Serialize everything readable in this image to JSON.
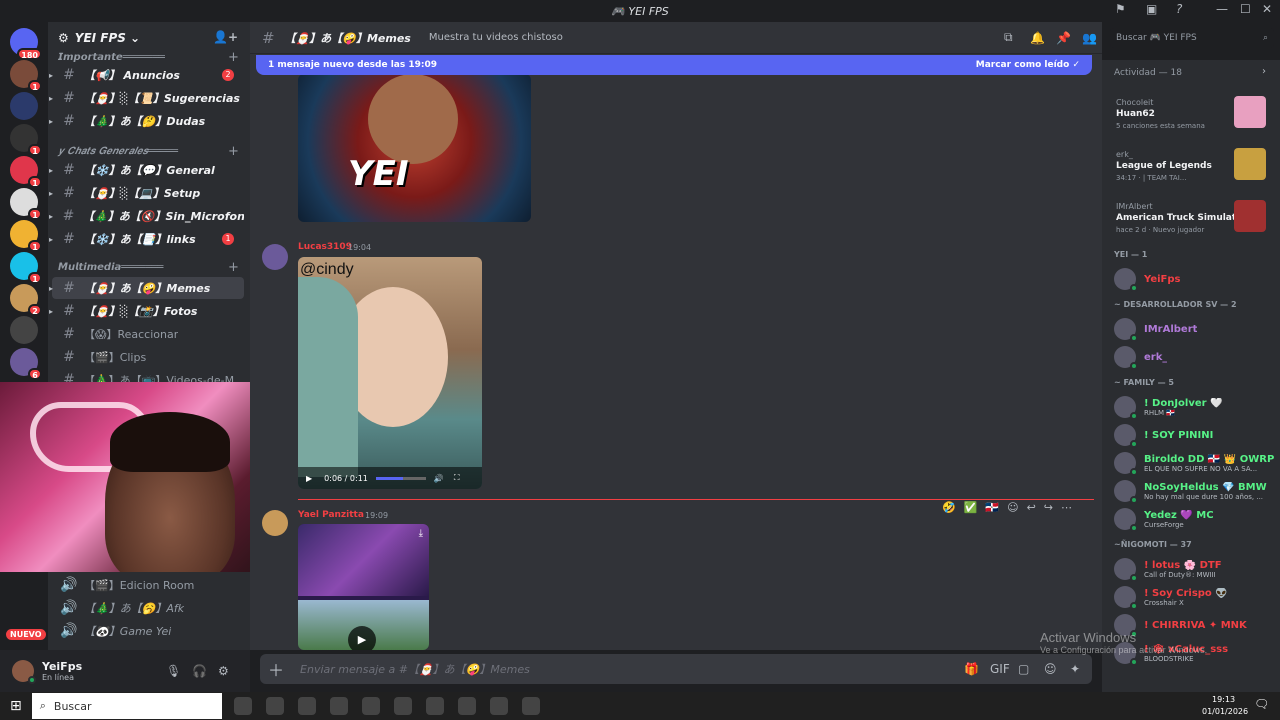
{
  "window": {
    "title": "🎮 YEI FPS"
  },
  "servers": [
    {
      "name": "home",
      "badge": "180",
      "color": "#5865f2"
    },
    {
      "name": "server-2",
      "badge": "1",
      "color": "#7a4b3a"
    },
    {
      "name": "server-3",
      "badge": "",
      "color": "#2b3a6b"
    },
    {
      "name": "server-4",
      "badge": "1",
      "color": "#333"
    },
    {
      "name": "server-5",
      "badge": "1",
      "color": "#e0364b"
    },
    {
      "name": "server-6",
      "badge": "1",
      "color": "#ddd"
    },
    {
      "name": "server-7",
      "badge": "1",
      "color": "#f0b232"
    },
    {
      "name": "server-8",
      "badge": "1",
      "color": "#19c0e8"
    },
    {
      "name": "server-9",
      "badge": "2",
      "color": "#c89a5a"
    },
    {
      "name": "server-10",
      "badge": "",
      "color": "#444"
    },
    {
      "name": "server-11",
      "badge": "6",
      "color": "#6b5a9a"
    }
  ],
  "sidebar": {
    "server_name": "YEI FPS",
    "categories": [
      {
        "label": "𝙄𝙢𝙥𝙤𝙧𝙩𝙖𝙣𝙩𝙚═══════"
      },
      {
        "label": "𝒚 𝑪𝒉𝒂𝒕𝒔 𝑮𝒆𝒏𝒆𝒓𝒂𝒍𝒆𝒔═════"
      },
      {
        "label": "𝙈𝙪𝙡𝙩𝙞𝙢𝙚𝙙𝙞𝙖═══════"
      }
    ],
    "channels": [
      {
        "label": "【📢】 Anuncios",
        "unread": "2"
      },
      {
        "label": "【🎅】░【📜】Sugerencias",
        "unread": ""
      },
      {
        "label": "【🎄】あ【🤔】Dudas",
        "unread": ""
      },
      {
        "label": "【❄️】あ【💬】General",
        "unread": ""
      },
      {
        "label": "【🎅】░【💻】Setup",
        "unread": ""
      },
      {
        "label": "【🎄】あ【🔇】Sin_Microfono",
        "unread": ""
      },
      {
        "label": "【❄️】あ【📑】links",
        "unread": "1"
      },
      {
        "label": "【🎅】あ【🤪】Memes",
        "unread": ""
      },
      {
        "label": "【🎅】░【📸】Fotos",
        "unread": ""
      },
      {
        "label": "【😱】Reaccionar",
        "unread": ""
      },
      {
        "label": "【🎬】Clips",
        "unread": ""
      },
      {
        "label": "【🎄】あ【📺】Videos-de-M...",
        "unread": ""
      }
    ],
    "voice_channels": [
      {
        "label": "【🎬】Edicion Room"
      },
      {
        "label": "【🎄】あ【🥱】Afk"
      },
      {
        "label": "【🐼】Game Yei"
      }
    ],
    "new_badge": "NUEVO"
  },
  "user": {
    "name": "YeiFps",
    "status": "En línea"
  },
  "channel": {
    "name": "【🎅】あ【🤪】Memes",
    "topic": "Muestra tu videos chistoso"
  },
  "banner": {
    "text": "1 mensaje nuevo desde las 19:09",
    "action": "Marcar como leído"
  },
  "messages": [
    {
      "author": "Lucas3109",
      "time": "19:04",
      "image_caption": "@cindy",
      "player_time": "0:06 / 0:11"
    },
    {
      "author": "Yael Panzitta",
      "time": "19:09"
    }
  ],
  "composer": {
    "placeholder": "Enviar mensaje a #【🎅】あ【🤪】Memes"
  },
  "search": {
    "placeholder": "Buscar 🎮 YEI FPS"
  },
  "members": {
    "activity_header": "Actividad — 18",
    "activities": [
      {
        "user": "Chocoleit",
        "detail": "Huan62",
        "sub": "5 canciones esta semana",
        "thumb": "#e8a0c0"
      },
      {
        "user": "erk_",
        "detail": "League of Legends",
        "sub": "34:17 · | TEAM TAI...",
        "thumb": "#c8a040"
      },
      {
        "user": "IMrAlbert",
        "detail": "American Truck Simulator",
        "sub": "hace 2 d · Nuevo jugador",
        "thumb": "#a03030"
      }
    ],
    "groups": [
      {
        "title": "YEI — 1",
        "members": [
          {
            "name": "YeiFps",
            "sub": "",
            "color": "#f23f43"
          }
        ]
      },
      {
        "title": "~ DESARROLLADOR SV — 2",
        "members": [
          {
            "name": "IMrAlbert",
            "sub": "",
            "color": "#b07ad8"
          },
          {
            "name": "erk_",
            "sub": "",
            "color": "#b07ad8"
          }
        ]
      },
      {
        "title": "~ FAMILY — 5",
        "members": [
          {
            "name": "! DonJolver 🤍",
            "sub": "RHLM 🇩🇴",
            "color": "#57f287"
          },
          {
            "name": "! SOY PININI",
            "sub": "",
            "color": "#57f287"
          },
          {
            "name": "Biroldo DD 🇩🇴 👑 OWRP",
            "sub": "EL QUE NO SUFRE NO VA A SA...",
            "color": "#57f287"
          },
          {
            "name": "NoSoyHeldus 💎 BMW",
            "sub": "No hay mal que dure 100 años, ...",
            "color": "#57f287"
          },
          {
            "name": "Yedez 💜 MC",
            "sub": "CurseForge",
            "color": "#57f287"
          }
        ]
      },
      {
        "title": "~ÑIGOMOTI — 37",
        "members": [
          {
            "name": "! lotus 🌸 DTF",
            "sub": "Call of Duty®: MWIII",
            "color": "#f23f43"
          },
          {
            "name": "! Soy Crispo 👽",
            "sub": "Crosshair X",
            "color": "#f23f43"
          },
          {
            "name": "! CHIRRIVA ✦ MNK",
            "sub": "",
            "color": "#f23f43"
          },
          {
            "name": "! 🕸 xCaluc_sss",
            "sub": "BLOODSTRIKE",
            "color": "#f23f43"
          }
        ]
      }
    ]
  },
  "watermark": {
    "line1": "Activar Windows",
    "line2": "Ve a Configuración para activar Windows."
  },
  "taskbar": {
    "search": "Buscar",
    "time": "19:13",
    "date": "01/01/2026"
  }
}
